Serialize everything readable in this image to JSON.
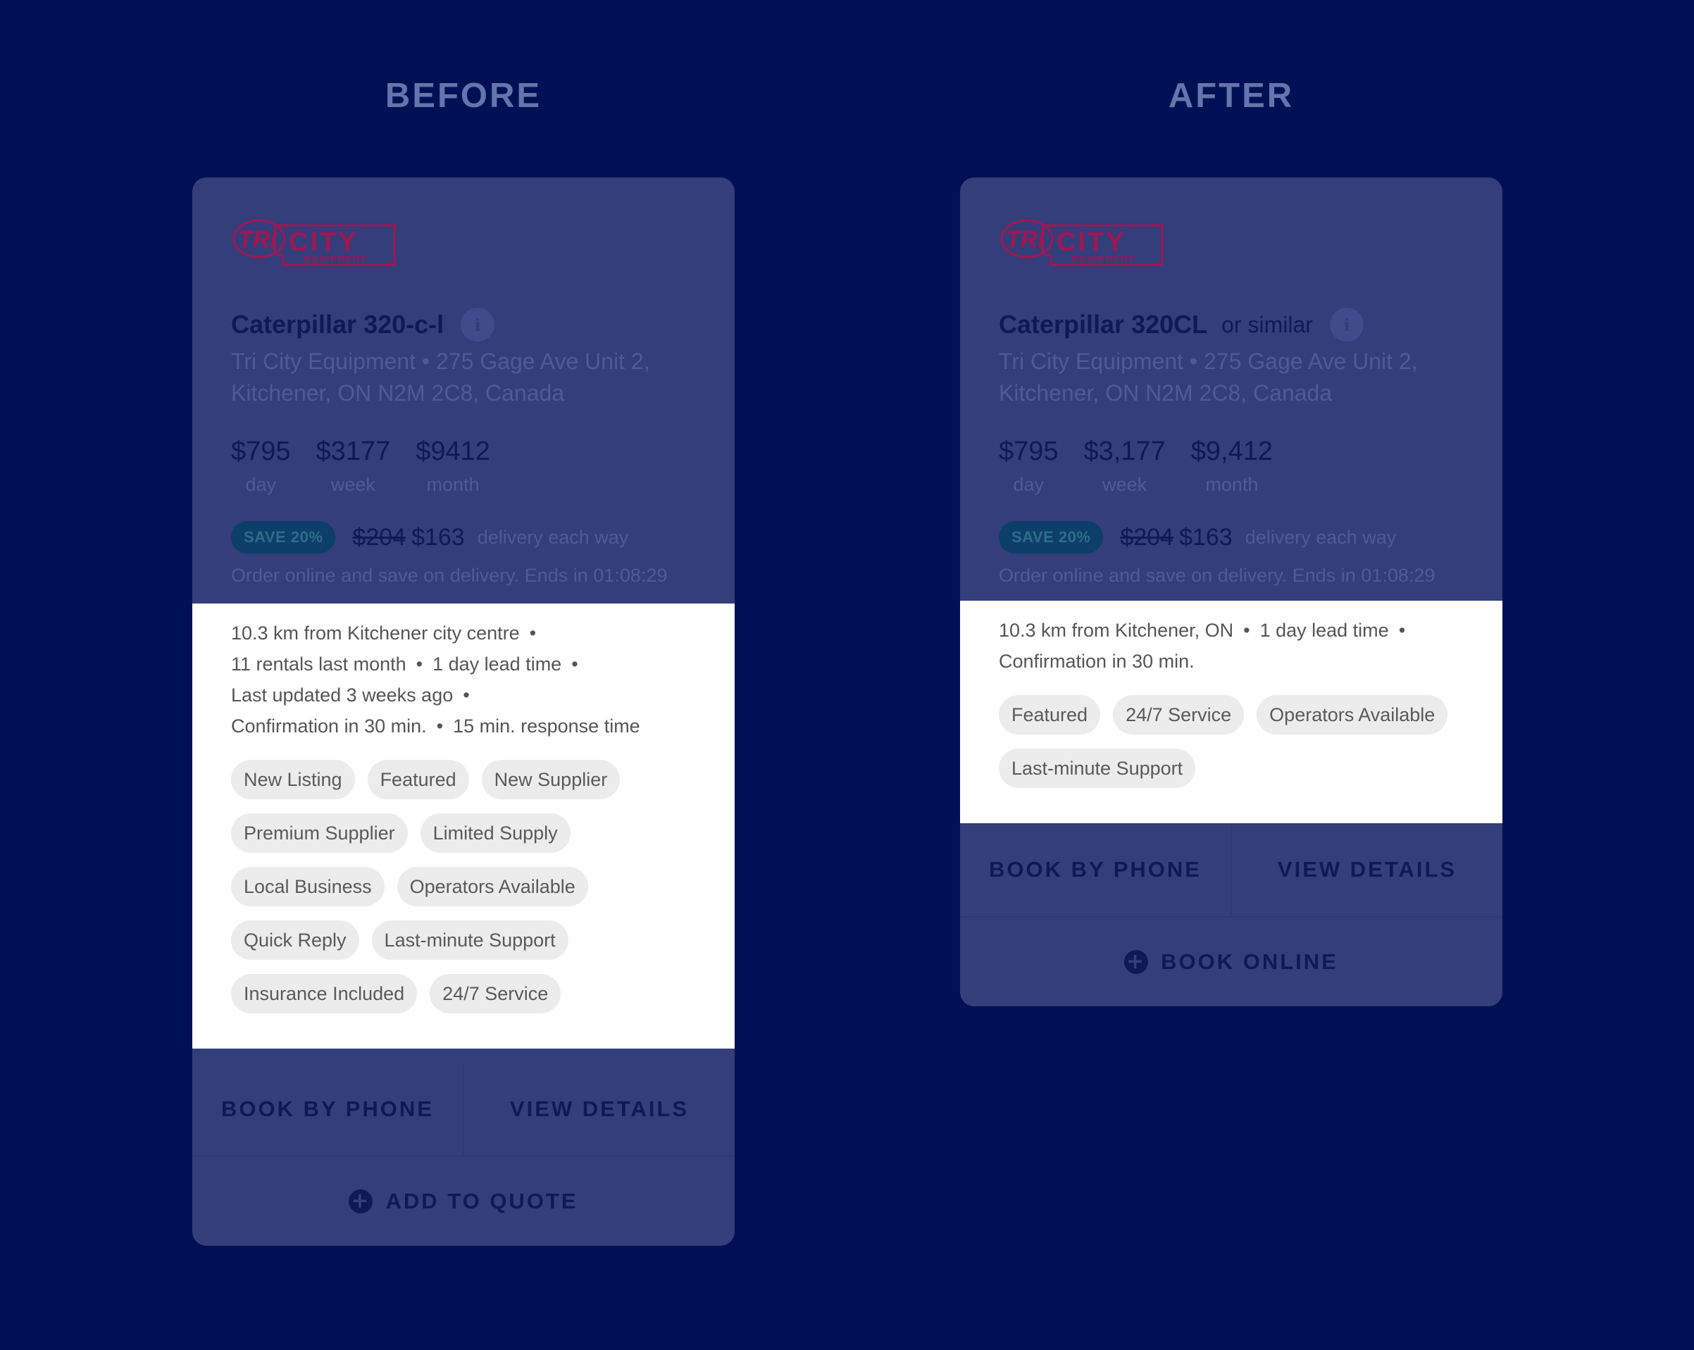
{
  "before": {
    "heading": "BEFORE",
    "logo": {
      "line1": "TRI",
      "line2": "CITY",
      "line3": "EQUIPMENT"
    },
    "title": "Caterpillar 320-c-l",
    "title_suffix": "",
    "address_line1": "Tri City Equipment  •  275 Gage Ave Unit 2,",
    "address_line2": "Kitchener, ON N2M 2C8, Canada",
    "prices": [
      {
        "amount": "$795",
        "period": "day"
      },
      {
        "amount": "$3177",
        "period": "week"
      },
      {
        "amount": "$9412",
        "period": "month"
      }
    ],
    "save_badge": "SAVE 20%",
    "old_price": "$204",
    "new_price": "$163",
    "delivery_text": "delivery each way",
    "promo": "Order online and save on delivery. Ends in 01:08:29",
    "meta_lines": [
      [
        "10.3 km from Kitchener city centre"
      ],
      [
        "11 rentals last month",
        "1 day lead time"
      ],
      [
        "Last updated 3 weeks ago"
      ],
      [
        "Confirmation in 30 min.",
        "15 min. response time"
      ]
    ],
    "tags": [
      "New Listing",
      "Featured",
      "New Supplier",
      "Premium Supplier",
      "Limited Supply",
      "Local Business",
      "Operators Available",
      "Quick Reply",
      "Last-minute Support",
      "Insurance Included",
      "24/7 Service"
    ],
    "action_left": "BOOK BY PHONE",
    "action_right": "VIEW DETAILS",
    "primary_action": "ADD TO QUOTE"
  },
  "after": {
    "heading": "AFTER",
    "logo": {
      "line1": "TRI",
      "line2": "CITY",
      "line3": "EQUIPMENT"
    },
    "title": "Caterpillar 320CL",
    "title_suffix": "or similar",
    "address_line1": "Tri City Equipment  •  275 Gage Ave Unit 2,",
    "address_line2": "Kitchener, ON N2M 2C8, Canada",
    "prices": [
      {
        "amount": "$795",
        "period": "day"
      },
      {
        "amount": "$3,177",
        "period": "week"
      },
      {
        "amount": "$9,412",
        "period": "month"
      }
    ],
    "save_badge": "SAVE 20%",
    "old_price": "$204",
    "new_price": "$163",
    "delivery_text": "delivery each way",
    "promo": "Order online and save on delivery. Ends in 01:08:29",
    "meta_lines": [
      [
        "10.3 km from Kitchener, ON",
        "1 day lead time"
      ],
      [
        "Confirmation in 30 min."
      ]
    ],
    "tags": [
      "Featured",
      "24/7 Service",
      "Operators Available",
      "Last-minute Support"
    ],
    "action_left": "BOOK BY PHONE",
    "action_right": "VIEW DETAILS",
    "primary_action": "BOOK ONLINE"
  },
  "colors": {
    "background": "#001055",
    "card": "#333e7a",
    "logo_red": "#a01650",
    "text_dark": "#0f1a55",
    "tag_bg": "#ececec"
  }
}
